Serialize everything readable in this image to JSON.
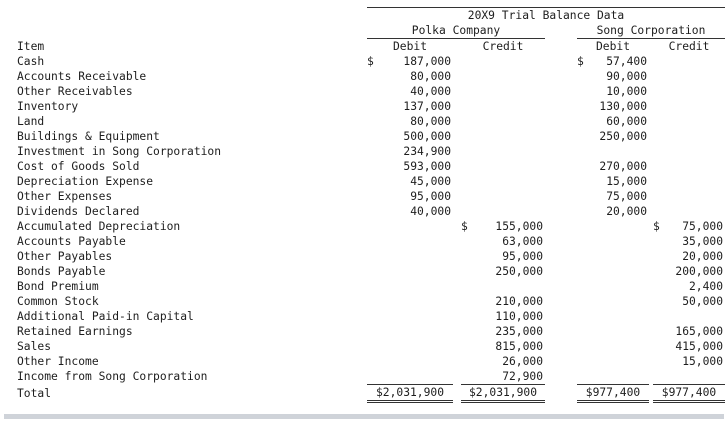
{
  "header": {
    "title": "20X9 Trial Balance Data",
    "company1": "Polka Company",
    "company2": "Song Corporation",
    "item_label": "Item",
    "debit_label": "Debit",
    "credit_label": "Credit"
  },
  "rows": [
    {
      "item": "Cash",
      "pd": "187,000",
      "pd_dollar": "$",
      "pc": "",
      "pc_dollar": "",
      "sd": "57,400",
      "sd_dollar": "$",
      "sc": "",
      "sc_dollar": ""
    },
    {
      "item": "Accounts Receivable",
      "pd": "80,000",
      "pd_dollar": "",
      "pc": "",
      "pc_dollar": "",
      "sd": "90,000",
      "sd_dollar": "",
      "sc": "",
      "sc_dollar": ""
    },
    {
      "item": "Other Receivables",
      "pd": "40,000",
      "pd_dollar": "",
      "pc": "",
      "pc_dollar": "",
      "sd": "10,000",
      "sd_dollar": "",
      "sc": "",
      "sc_dollar": ""
    },
    {
      "item": "Inventory",
      "pd": "137,000",
      "pd_dollar": "",
      "pc": "",
      "pc_dollar": "",
      "sd": "130,000",
      "sd_dollar": "",
      "sc": "",
      "sc_dollar": ""
    },
    {
      "item": "Land",
      "pd": "80,000",
      "pd_dollar": "",
      "pc": "",
      "pc_dollar": "",
      "sd": "60,000",
      "sd_dollar": "",
      "sc": "",
      "sc_dollar": ""
    },
    {
      "item": "Buildings & Equipment",
      "pd": "500,000",
      "pd_dollar": "",
      "pc": "",
      "pc_dollar": "",
      "sd": "250,000",
      "sd_dollar": "",
      "sc": "",
      "sc_dollar": ""
    },
    {
      "item": "Investment in Song Corporation",
      "pd": "234,900",
      "pd_dollar": "",
      "pc": "",
      "pc_dollar": "",
      "sd": "",
      "sd_dollar": "",
      "sc": "",
      "sc_dollar": ""
    },
    {
      "item": "Cost of Goods Sold",
      "pd": "593,000",
      "pd_dollar": "",
      "pc": "",
      "pc_dollar": "",
      "sd": "270,000",
      "sd_dollar": "",
      "sc": "",
      "sc_dollar": ""
    },
    {
      "item": "Depreciation Expense",
      "pd": "45,000",
      "pd_dollar": "",
      "pc": "",
      "pc_dollar": "",
      "sd": "15,000",
      "sd_dollar": "",
      "sc": "",
      "sc_dollar": ""
    },
    {
      "item": "Other Expenses",
      "pd": "95,000",
      "pd_dollar": "",
      "pc": "",
      "pc_dollar": "",
      "sd": "75,000",
      "sd_dollar": "",
      "sc": "",
      "sc_dollar": ""
    },
    {
      "item": "Dividends Declared",
      "pd": "40,000",
      "pd_dollar": "",
      "pc": "",
      "pc_dollar": "",
      "sd": "20,000",
      "sd_dollar": "",
      "sc": "",
      "sc_dollar": ""
    },
    {
      "item": "Accumulated Depreciation",
      "pd": "",
      "pd_dollar": "",
      "pc": "155,000",
      "pc_dollar": "$",
      "sd": "",
      "sd_dollar": "",
      "sc": "75,000",
      "sc_dollar": "$"
    },
    {
      "item": "Accounts Payable",
      "pd": "",
      "pd_dollar": "",
      "pc": "63,000",
      "pc_dollar": "",
      "sd": "",
      "sd_dollar": "",
      "sc": "35,000",
      "sc_dollar": ""
    },
    {
      "item": "Other Payables",
      "pd": "",
      "pd_dollar": "",
      "pc": "95,000",
      "pc_dollar": "",
      "sd": "",
      "sd_dollar": "",
      "sc": "20,000",
      "sc_dollar": ""
    },
    {
      "item": "Bonds Payable",
      "pd": "",
      "pd_dollar": "",
      "pc": "250,000",
      "pc_dollar": "",
      "sd": "",
      "sd_dollar": "",
      "sc": "200,000",
      "sc_dollar": ""
    },
    {
      "item": "Bond Premium",
      "pd": "",
      "pd_dollar": "",
      "pc": "",
      "pc_dollar": "",
      "sd": "",
      "sd_dollar": "",
      "sc": "2,400",
      "sc_dollar": ""
    },
    {
      "item": "Common Stock",
      "pd": "",
      "pd_dollar": "",
      "pc": "210,000",
      "pc_dollar": "",
      "sd": "",
      "sd_dollar": "",
      "sc": "50,000",
      "sc_dollar": ""
    },
    {
      "item": "Additional Paid-in Capital",
      "pd": "",
      "pd_dollar": "",
      "pc": "110,000",
      "pc_dollar": "",
      "sd": "",
      "sd_dollar": "",
      "sc": "",
      "sc_dollar": ""
    },
    {
      "item": "Retained Earnings",
      "pd": "",
      "pd_dollar": "",
      "pc": "235,000",
      "pc_dollar": "",
      "sd": "",
      "sd_dollar": "",
      "sc": "165,000",
      "sc_dollar": ""
    },
    {
      "item": "Sales",
      "pd": "",
      "pd_dollar": "",
      "pc": "815,000",
      "pc_dollar": "",
      "sd": "",
      "sd_dollar": "",
      "sc": "415,000",
      "sc_dollar": ""
    },
    {
      "item": "Other Income",
      "pd": "",
      "pd_dollar": "",
      "pc": "26,000",
      "pc_dollar": "",
      "sd": "",
      "sd_dollar": "",
      "sc": "15,000",
      "sc_dollar": ""
    },
    {
      "item": "Income from Song Corporation",
      "pd": "",
      "pd_dollar": "",
      "pc": "72,900",
      "pc_dollar": "",
      "sd": "",
      "sd_dollar": "",
      "sc": "",
      "sc_dollar": ""
    }
  ],
  "total": {
    "label": "Total",
    "pd": "$2,031,900",
    "pc": "$2,031,900",
    "sd": "$977,400",
    "sc": "$977,400"
  }
}
